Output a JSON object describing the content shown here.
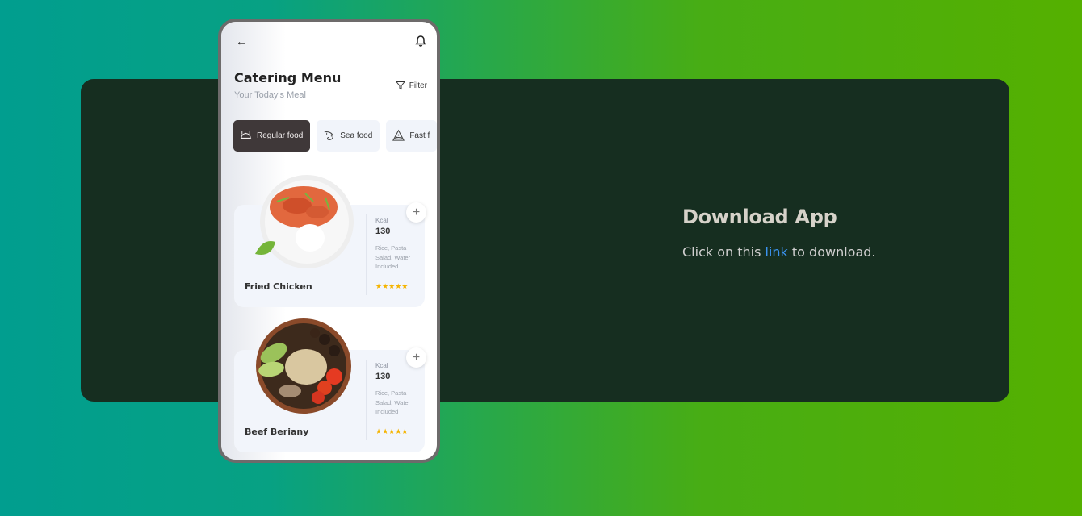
{
  "app": {
    "back_icon": "arrow-left-icon",
    "notification_icon": "bell-icon",
    "title": "Catering Menu",
    "subtitle": "Your Today's Meal",
    "filter_label": "Filter",
    "filter_icon": "funnel-icon",
    "categories": [
      {
        "label": "Regular food",
        "icon": "dish-icon",
        "active": true
      },
      {
        "label": "Sea food",
        "icon": "shrimp-icon",
        "active": false
      },
      {
        "label": "Fast f",
        "icon": "pizza-icon",
        "active": false
      }
    ],
    "items": [
      {
        "name": "Fried Chicken",
        "kcal_label": "Kcal",
        "kcal": "130",
        "description": "Rice, Pasta Salad, Water Included",
        "stars": "★★★★★",
        "add": "+"
      },
      {
        "name": "Beef Beriany",
        "kcal_label": "Kcal",
        "kcal": "130",
        "description": "Rice, Pasta Salad, Water Included",
        "stars": "★★★★★",
        "add": "+"
      }
    ]
  },
  "cta": {
    "heading": "Download App",
    "text_before": "Click on this",
    "link_label": "link",
    "text_after": "to download."
  },
  "colors": {
    "panel": "#162e20",
    "active_chip": "#3f3839",
    "link": "#3b93f0",
    "stars": "#f5b400"
  }
}
